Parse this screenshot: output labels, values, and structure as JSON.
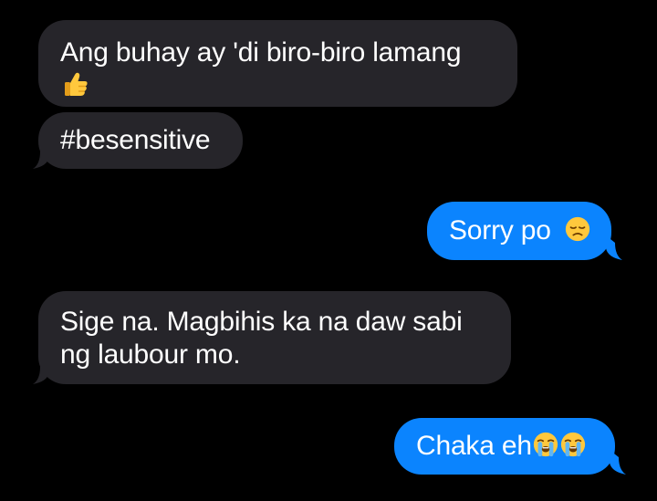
{
  "messages": [
    {
      "side": "received",
      "lines": [
        "Ang buhay ay 'di biro-biro lamang"
      ],
      "emoji": "thumbs-up"
    },
    {
      "side": "received",
      "lines": [
        "#besensitive"
      ]
    },
    {
      "side": "sent",
      "lines": [
        "Sorry po"
      ],
      "emoji": "disappointed-face"
    },
    {
      "side": "received",
      "lines": [
        "Sige na. Magbihis ka na daw sabi",
        "ng laubour mo."
      ]
    },
    {
      "side": "sent",
      "lines": [
        "Chaka eh"
      ],
      "emoji": "loudly-crying-face x2"
    }
  ],
  "colors": {
    "background": "#000000",
    "received_bubble": "#26252a",
    "sent_bubble": "#0b84fe",
    "text": "#ffffff"
  }
}
